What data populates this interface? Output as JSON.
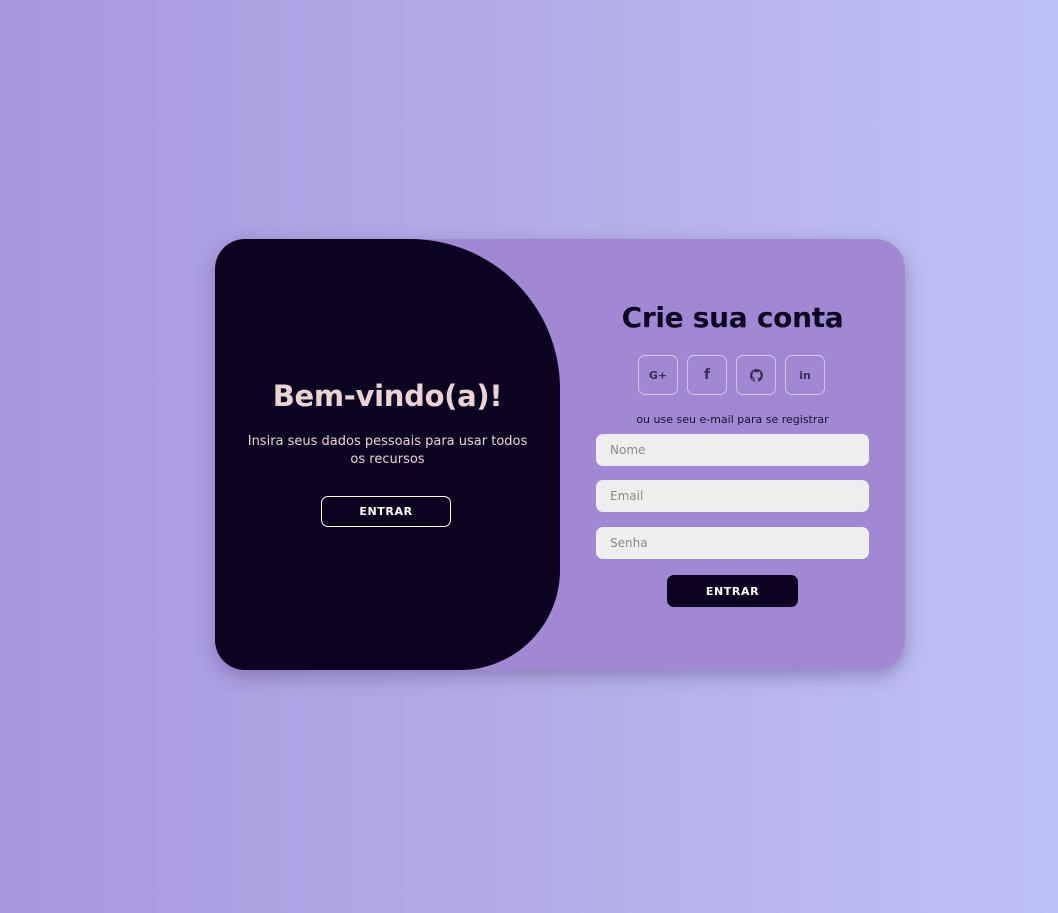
{
  "signin_panel": {
    "title": "Bem-vindo(a)!",
    "text": "Insira seus dados pessoais para usar todos os recursos",
    "button_label": "ENTRAR"
  },
  "signup_panel": {
    "title": "Crie sua conta",
    "social": [
      {
        "label": "G+",
        "icon": "google-plus-icon"
      },
      {
        "label": "f",
        "icon": "facebook-icon"
      },
      {
        "label": "",
        "icon": "github-icon"
      },
      {
        "label": "in",
        "icon": "linkedin-icon"
      }
    ],
    "alt_text": "ou use seu e-mail para se registrar",
    "fields": {
      "name_placeholder": "Nome",
      "email_placeholder": "Email",
      "password_placeholder": "Senha"
    },
    "submit_label": "ENTRAR"
  },
  "colors": {
    "background_start": "#a897dd",
    "background_end": "#bfc2f4",
    "card": "#a088d3",
    "dark": "#0b0320",
    "light_text": "#ead3d4",
    "input_bg": "#eeeeee"
  }
}
